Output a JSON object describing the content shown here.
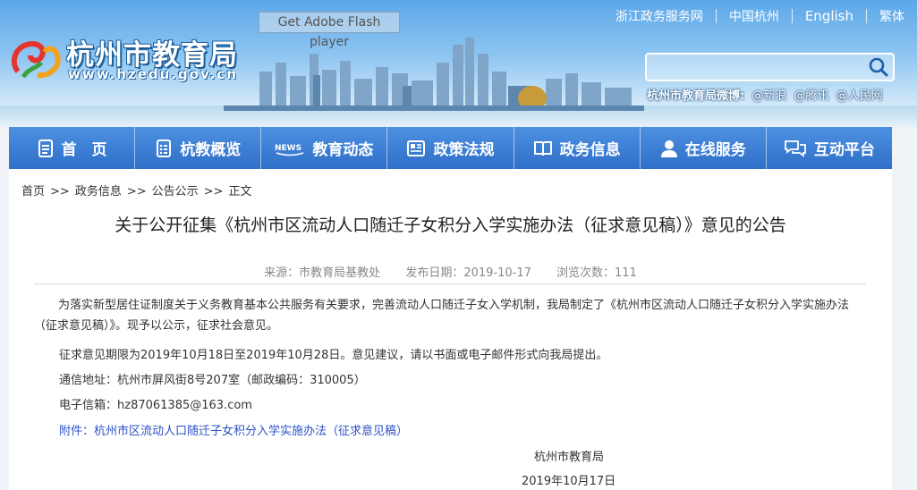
{
  "header": {
    "logo_title": "杭州市教育局",
    "logo_url": "www.hzedu.gov.cn",
    "flash_text": "Get Adobe Flash player",
    "top_links": [
      "浙江政务服务网",
      "中国杭州",
      "English",
      "繁体"
    ],
    "weibo_label": "杭州市教育局微博:",
    "weibo_links": [
      "@新浪",
      "@腾讯",
      "@人民网"
    ]
  },
  "nav": {
    "items": [
      {
        "label": "首　页",
        "icon": "home-doc-icon"
      },
      {
        "label": "杭教概览",
        "icon": "document-list-icon"
      },
      {
        "label": "教育动态",
        "icon": "news-icon"
      },
      {
        "label": "政策法规",
        "icon": "newspaper-icon"
      },
      {
        "label": "政务信息",
        "icon": "book-icon"
      },
      {
        "label": "在线服务",
        "icon": "user-service-icon"
      },
      {
        "label": "互动平台",
        "icon": "chat-bubbles-icon"
      }
    ]
  },
  "breadcrumb": [
    "首页",
    "政务信息",
    "公告公示",
    "正文"
  ],
  "article": {
    "title": "关于公开征集《杭州市区流动人口随迁子女积分入学实施办法（征求意见稿）》意见的公告",
    "source": "来源：市教育局基教处",
    "date": "发布日期：2019-10-17",
    "views": "浏览次数：111",
    "para1": "为落实新型居住证制度关于义务教育基本公共服务有关要求，完善流动人口随迁子女入学机制，我局制定了《杭州市区流动人口随迁子女积分入学实施办法（征求意见稿）》。现予以公示，征求社会意见。",
    "para2": "征求意见期限为2019年10月18日至2019年10月28日。意见建议，请以书面或电子邮件形式向我局提出。",
    "address": "通信地址：杭州市屏风街8号207室（邮政编码：310005）",
    "email_label": "电子信箱：",
    "email": "hz87061385@163.com",
    "attachment": "附件：杭州市区流动人口随迁子女积分入学实施办法（征求意见稿）",
    "signer": "杭州市教育局",
    "sign_date": "2019年10月17日"
  },
  "colors": {
    "nav_bg": "#3a7dd6",
    "link": "#2d51c8",
    "header_sky": "#5ca7e8"
  }
}
